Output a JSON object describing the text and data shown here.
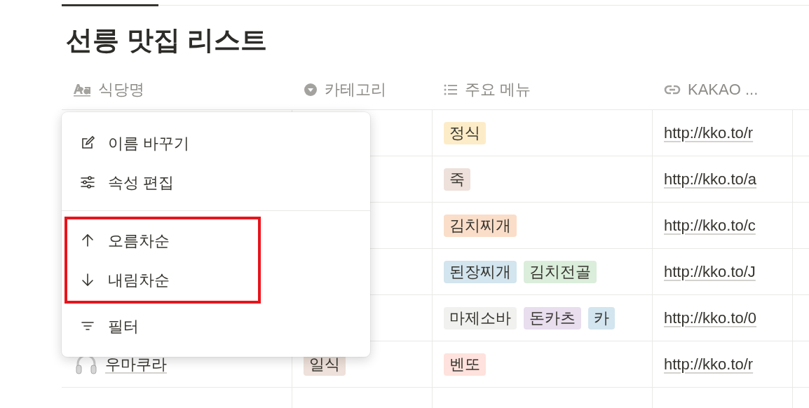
{
  "title": "선릉 맛집 리스트",
  "columns": [
    {
      "kind": "title",
      "label": "식당명"
    },
    {
      "kind": "select",
      "label": "카테고리"
    },
    {
      "kind": "multi",
      "label": "주요 메뉴"
    },
    {
      "kind": "url",
      "label": "KAKAO ..."
    }
  ],
  "rows": [
    {
      "menu": [
        {
          "label": "정식",
          "color": "#fdecc8"
        }
      ],
      "link": "http://kko.to/r"
    },
    {
      "menu": [
        {
          "label": "죽",
          "color": "#eee0da"
        }
      ],
      "link": "http://kko.to/a"
    },
    {
      "menu": [
        {
          "label": "김치찌개",
          "color": "#fadec9"
        }
      ],
      "link": "http://kko.to/c"
    },
    {
      "menu": [
        {
          "label": "된장찌개",
          "color": "#d3e5ef"
        },
        {
          "label": "김치전골",
          "color": "#dbeddb"
        }
      ],
      "link": "http://kko.to/J"
    },
    {
      "menu": [
        {
          "label": "마제소바",
          "color": "#f1f1ef"
        },
        {
          "label": "돈카츠",
          "color": "#e8deee"
        },
        {
          "label": "카",
          "color": "#d3e5ef"
        }
      ],
      "link": "http://kko.to/0"
    },
    {
      "name": "우마쿠라",
      "category": {
        "label": "일식",
        "color": "#eee0da"
      },
      "menu": [
        {
          "label": "벤또",
          "color": "#ffe2dd"
        }
      ],
      "link": "http://kko.to/r"
    }
  ],
  "context_menu": {
    "groups": [
      {
        "highlighted": false,
        "items": [
          {
            "kind": "rename",
            "label": "이름 바꾸기"
          },
          {
            "kind": "edit",
            "label": "속성 편집"
          }
        ]
      },
      {
        "highlighted": true,
        "items": [
          {
            "kind": "asc",
            "label": "오름차순"
          },
          {
            "kind": "desc",
            "label": "내림차순"
          }
        ]
      },
      {
        "highlighted": false,
        "items": [
          {
            "kind": "filter",
            "label": "필터"
          }
        ]
      }
    ]
  }
}
